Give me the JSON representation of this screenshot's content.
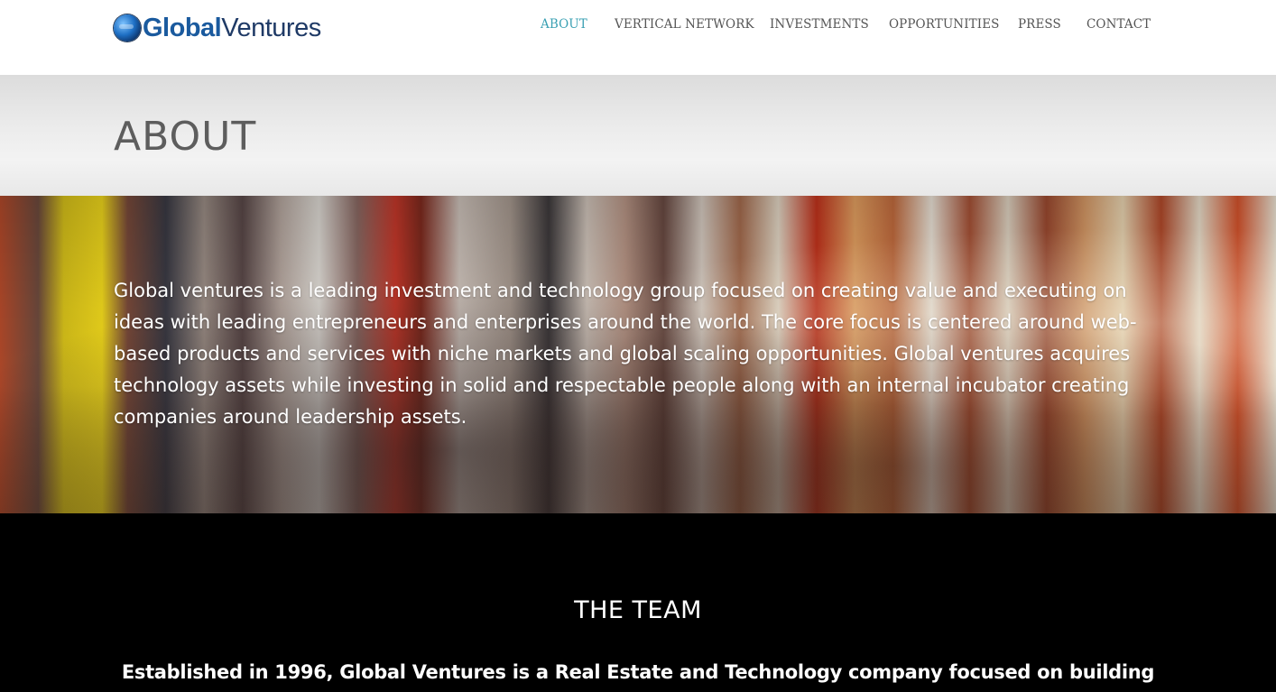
{
  "header": {
    "logo_part1": "Global",
    "logo_part2": "Ventures",
    "nav": [
      {
        "label": "ABOUT",
        "active": true
      },
      {
        "label": "VERTICAL NETWORK",
        "active": false
      },
      {
        "label": "INVESTMENTS",
        "active": false
      },
      {
        "label": "OPPORTUNITIES",
        "active": false
      },
      {
        "label": "PRESS",
        "active": false
      },
      {
        "label": "CONTACT",
        "active": false
      }
    ]
  },
  "page_title": "ABOUT",
  "hero": {
    "text": "Global ventures is a leading investment and technology group focused on creating value and executing on ideas with leading entrepreneurs and enterprises around the world. The core focus is centered around web-based products and services with niche markets and global scaling opportunities. Global ventures acquires technology assets while investing in solid and respectable people along with an internal incubator creating companies around leadership assets."
  },
  "team": {
    "title": "THE TEAM",
    "description": "Established in 1996, Global Ventures is a Real Estate and Technology company focused on building"
  },
  "colors": {
    "nav_active": "#3aa0b3",
    "nav_default": "#555555",
    "logo_primary": "#1a5a9e",
    "logo_secondary": "#1f3a66",
    "team_bg": "#000000"
  },
  "icons": {
    "logo_mark": "globe-icon"
  }
}
